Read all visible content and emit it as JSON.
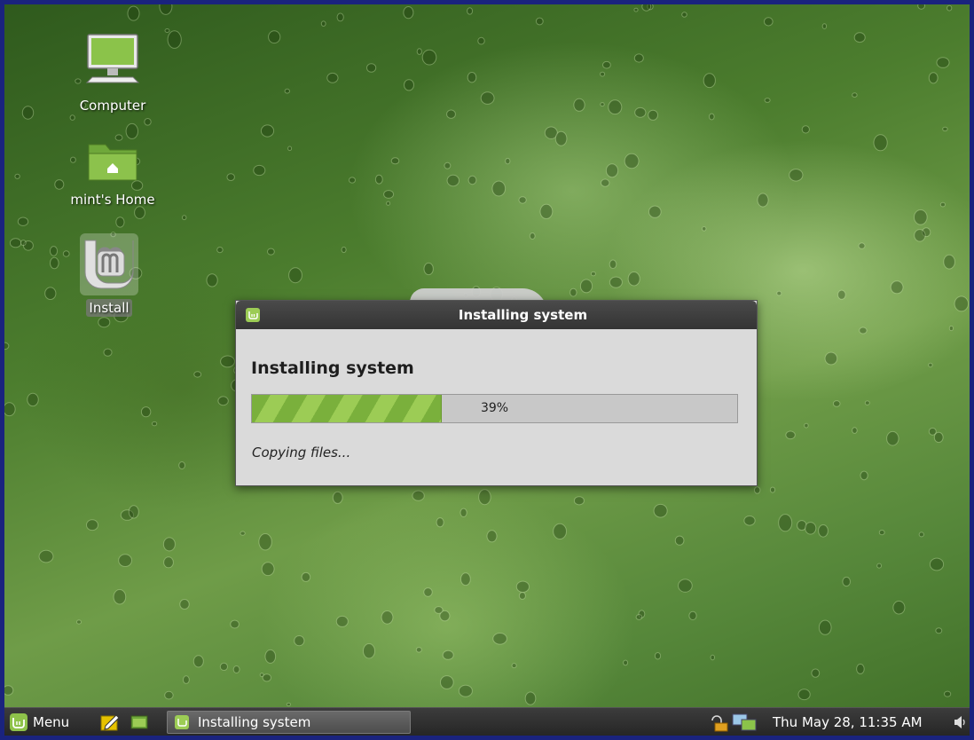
{
  "desktop": {
    "icons": [
      {
        "label": "Computer",
        "icon": "computer-icon"
      },
      {
        "label": "mint's Home",
        "icon": "home-folder-icon"
      },
      {
        "label": "Install",
        "icon": "mint-install-icon"
      }
    ]
  },
  "dialog": {
    "window_title": "Installing system",
    "heading": "Installing system",
    "progress_fraction": 0.39,
    "progress_text": "39%",
    "status": "Copying files..."
  },
  "taskbar": {
    "menu_label": "Menu",
    "launchers": [
      "text-editor-icon",
      "terminal-icon"
    ],
    "task_label": "Installing system",
    "tray": [
      "network-icon"
    ],
    "clock": "Thu May 28, 11:35 AM",
    "volume_icon": "volume-icon"
  },
  "colors": {
    "accent": "#87c34a",
    "taskbar": "#2f2f2f",
    "titlebar": "#3c3c3c",
    "dialog_bg": "#dadada"
  }
}
